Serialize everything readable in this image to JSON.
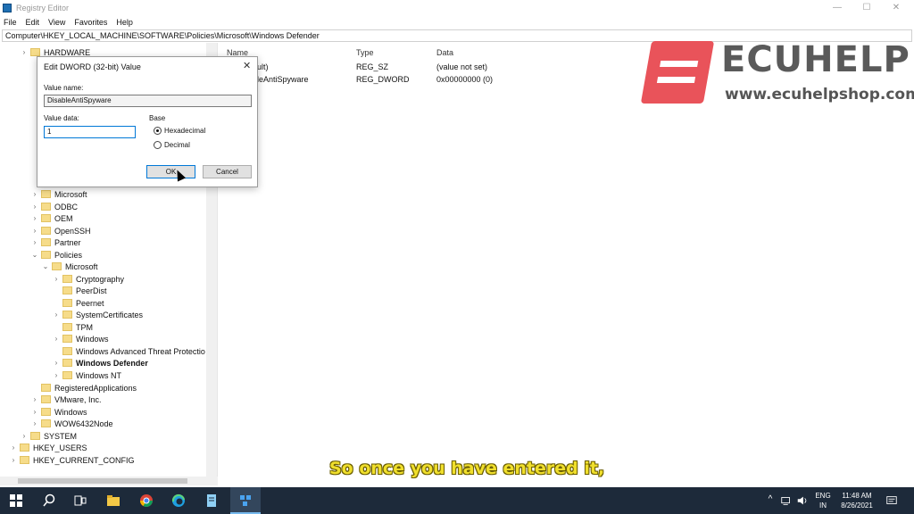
{
  "window": {
    "title": "Registry Editor",
    "min_glyph": "—",
    "max_glyph": "☐",
    "close_glyph": "✕"
  },
  "menu": [
    "File",
    "Edit",
    "View",
    "Favorites",
    "Help"
  ],
  "address": "Computer\\HKEY_LOCAL_MACHINE\\SOFTWARE\\Policies\\Microsoft\\Windows Defender",
  "tree": [
    {
      "label": "HARDWARE",
      "chev": "›",
      "depth": 0
    },
    {
      "label": "Microsoft",
      "chev": "›",
      "depth": 1
    },
    {
      "label": "ODBC",
      "chev": "›",
      "depth": 1
    },
    {
      "label": "OEM",
      "chev": "›",
      "depth": 1
    },
    {
      "label": "OpenSSH",
      "chev": "›",
      "depth": 1
    },
    {
      "label": "Partner",
      "chev": "›",
      "depth": 1
    },
    {
      "label": "Policies",
      "chev": "⌄",
      "depth": 1
    },
    {
      "label": "Microsoft",
      "chev": "⌄",
      "depth": 2
    },
    {
      "label": "Cryptography",
      "chev": "›",
      "depth": 3
    },
    {
      "label": "PeerDist",
      "chev": "",
      "depth": 3
    },
    {
      "label": "Peernet",
      "chev": "",
      "depth": 3
    },
    {
      "label": "SystemCertificates",
      "chev": "›",
      "depth": 3
    },
    {
      "label": "TPM",
      "chev": "",
      "depth": 3
    },
    {
      "label": "Windows",
      "chev": "›",
      "depth": 3
    },
    {
      "label": "Windows Advanced Threat Protectio",
      "chev": "",
      "depth": 3
    },
    {
      "label": "Windows Defender",
      "chev": "›",
      "depth": 3
    },
    {
      "label": "Windows NT",
      "chev": "›",
      "depth": 3
    },
    {
      "label": "RegisteredApplications",
      "chev": "",
      "depth": 1
    },
    {
      "label": "VMware, Inc.",
      "chev": "›",
      "depth": 1
    },
    {
      "label": "Windows",
      "chev": "›",
      "depth": 1
    },
    {
      "label": "WOW6432Node",
      "chev": "›",
      "depth": 1
    },
    {
      "label": "SYSTEM",
      "chev": "›",
      "depth": 0
    },
    {
      "label": "HKEY_USERS",
      "chev": "›",
      "depth": -1
    },
    {
      "label": "HKEY_CURRENT_CONFIG",
      "chev": "›",
      "depth": -1
    }
  ],
  "list": {
    "headers": {
      "name": "Name",
      "type": "Type",
      "data": "Data"
    },
    "rows": [
      {
        "name": "ult)",
        "type": "REG_SZ",
        "data": "(value not set)"
      },
      {
        "name": "leAntiSpyware",
        "type": "REG_DWORD",
        "data": "0x00000000 (0)"
      }
    ]
  },
  "dialog": {
    "title": "Edit DWORD (32-bit) Value",
    "close": "✕",
    "value_name_label": "Value name:",
    "value_name": "DisableAntiSpyware",
    "value_data_label": "Value data:",
    "value_data": "1",
    "base_label": "Base",
    "hex_label": "Hexadecimal",
    "dec_label": "Decimal",
    "ok_label": "OK",
    "cancel_label": "Cancel"
  },
  "watermark": {
    "brand": "ECUHELP",
    "url": "www.ecuhelpshop.com"
  },
  "subtitle": "So once you have entered it,",
  "taskbar": {
    "lang_top": "ENG",
    "lang_bottom": "IN",
    "time": "11:48 AM",
    "date": "8/26/2021",
    "up_arrow": "^"
  },
  "colors": {
    "taskbar": "#1d2a3a",
    "accent": "#0078d7",
    "logo_red": "#e9535a",
    "subtitle": "#f0df2c"
  }
}
